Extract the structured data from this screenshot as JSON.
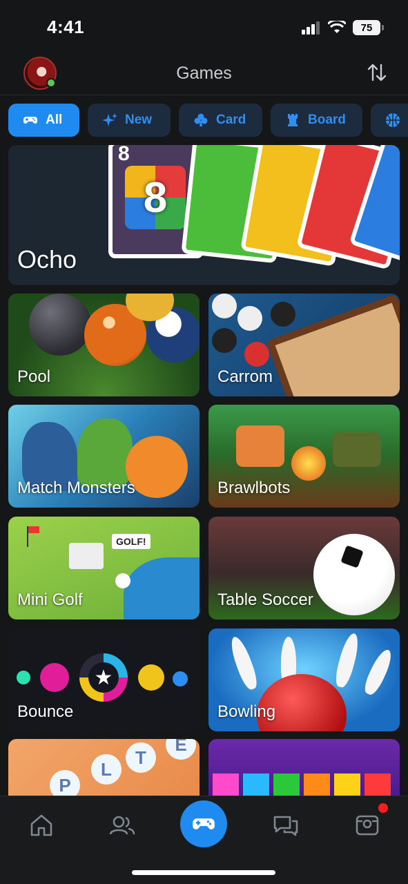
{
  "status": {
    "time": "4:41",
    "battery": "75"
  },
  "header": {
    "title": "Games"
  },
  "chips": [
    {
      "label": "All",
      "icon": "gamepad-icon",
      "active": true
    },
    {
      "label": "New",
      "icon": "sparkle-icon"
    },
    {
      "label": "Card",
      "icon": "club-icon"
    },
    {
      "label": "Board",
      "icon": "rook-icon"
    },
    {
      "label": "",
      "icon": "basketball-icon"
    }
  ],
  "games": {
    "hero": {
      "name": "Ocho",
      "card_number": "8"
    },
    "items": [
      {
        "name": "Pool"
      },
      {
        "name": "Carrom"
      },
      {
        "name": "Match Monsters"
      },
      {
        "name": "Brawlbots"
      },
      {
        "name": "Mini Golf",
        "sign": "GOLF!"
      },
      {
        "name": "Table Soccer"
      },
      {
        "name": "Bounce"
      },
      {
        "name": "Bowling"
      },
      {
        "name": "",
        "letters": "PLTE"
      },
      {
        "name": ""
      }
    ]
  },
  "nav": [
    {
      "name": "home-icon"
    },
    {
      "name": "friends-icon"
    },
    {
      "name": "games-icon",
      "active": true
    },
    {
      "name": "chat-icon"
    },
    {
      "name": "inbox-icon",
      "badge": true
    }
  ],
  "colors": {
    "accent": "#1f8af0",
    "chip_bg": "#1d2b3e",
    "background": "#151618"
  }
}
